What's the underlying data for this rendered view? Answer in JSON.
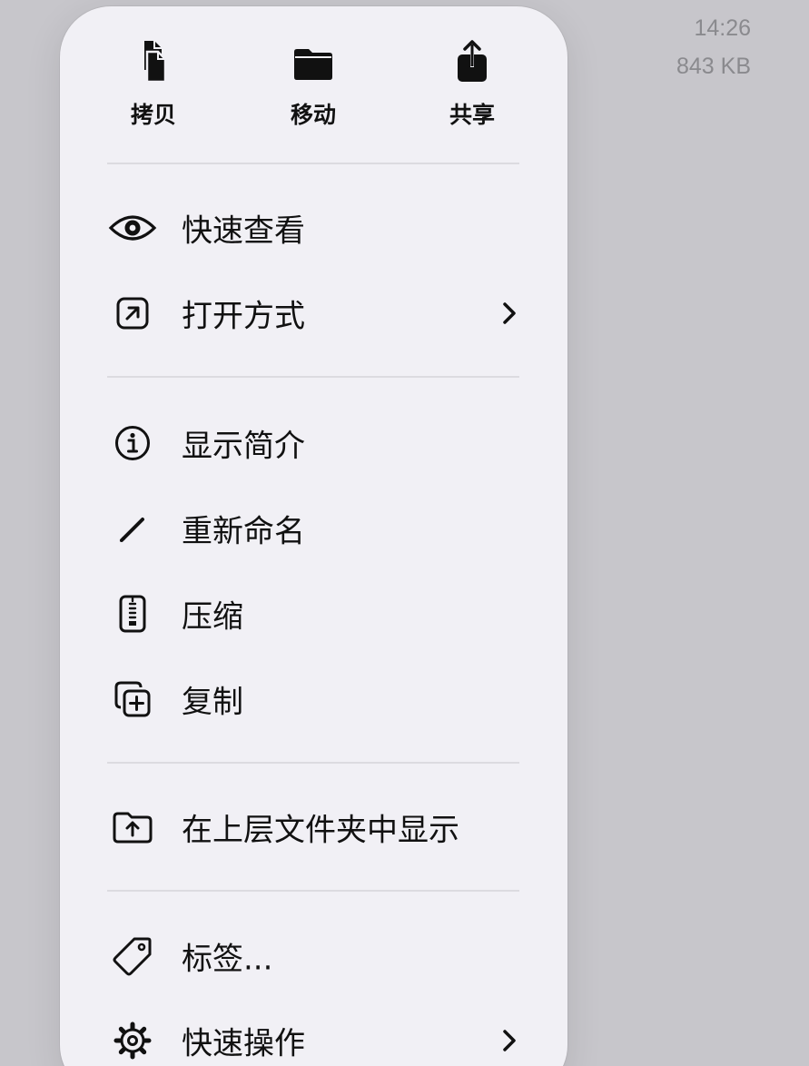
{
  "background": {
    "time": "14:26",
    "size": "843 KB"
  },
  "colors": {
    "backdrop": "#c7c6cb",
    "menu_bg": "#f1f0f5",
    "separator": "#dcdbe0",
    "text": "#111111",
    "secondary_text": "#8a8a8e"
  },
  "top_actions": [
    {
      "label": "拷贝",
      "icon": "copy-doc-icon"
    },
    {
      "label": "移动",
      "icon": "folder-icon"
    },
    {
      "label": "共享",
      "icon": "share-icon"
    }
  ],
  "menu": {
    "quick_look": {
      "label": "快速查看",
      "icon": "eye-icon"
    },
    "open_with": {
      "label": "打开方式",
      "icon": "open-external-icon",
      "has_submenu": true
    },
    "get_info": {
      "label": "显示简介",
      "icon": "info-circle-icon"
    },
    "rename": {
      "label": "重新命名",
      "icon": "pencil-icon"
    },
    "compress": {
      "label": "压缩",
      "icon": "zip-icon"
    },
    "duplicate": {
      "label": "复制",
      "icon": "duplicate-plus-icon"
    },
    "show_in_enclosing": {
      "label": "在上层文件夹中显示",
      "icon": "folder-up-icon"
    },
    "tags": {
      "label": "标签...",
      "icon": "tag-icon"
    },
    "quick_actions": {
      "label": "快速操作",
      "icon": "gear-icon",
      "has_submenu": true
    }
  }
}
